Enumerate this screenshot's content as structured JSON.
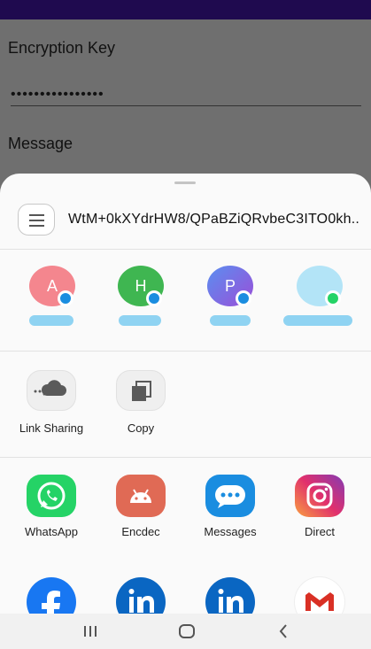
{
  "app": {
    "key_label": "Encryption Key",
    "key_value": "••••••••••••••••",
    "message_label": "Message"
  },
  "share": {
    "header_text": "WtM+0kXYdrHW8/QPaBZiQRvbeC3ITO0kh...",
    "contacts": [
      {
        "initial": "A",
        "color": "#f4868e",
        "badge": "message"
      },
      {
        "initial": "H",
        "color": "#3fb651",
        "badge": "message"
      },
      {
        "initial": "P",
        "color": "#7a66e0",
        "badge": "message"
      },
      {
        "initial": "",
        "color": "#b3e4f7",
        "badge": "whatsapp"
      }
    ],
    "actions": [
      {
        "label": "Link Sharing",
        "icon": "cloud-link-icon"
      },
      {
        "label": "Copy",
        "icon": "copy-icon"
      }
    ],
    "apps": [
      {
        "label": "WhatsApp",
        "icon": "whatsapp-icon",
        "color": "#25d366"
      },
      {
        "label": "Encdec",
        "icon": "android-icon",
        "color": "#e06a55"
      },
      {
        "label": "Messages",
        "icon": "messages-icon",
        "color": "#1a8de0"
      },
      {
        "label": "Direct",
        "icon": "instagram-icon",
        "color": "#c13584"
      }
    ],
    "apps_row2": [
      {
        "icon": "facebook-icon",
        "color": "#1877f2"
      },
      {
        "icon": "linkedin-icon",
        "color": "#0a66c2"
      },
      {
        "icon": "linkedin-icon",
        "color": "#0a66c2"
      },
      {
        "icon": "gmail-icon",
        "color": "#ffffff"
      }
    ]
  },
  "navigation": {
    "recents_icon": "recents-icon",
    "home_icon": "home-icon",
    "back_icon": "back-icon"
  }
}
